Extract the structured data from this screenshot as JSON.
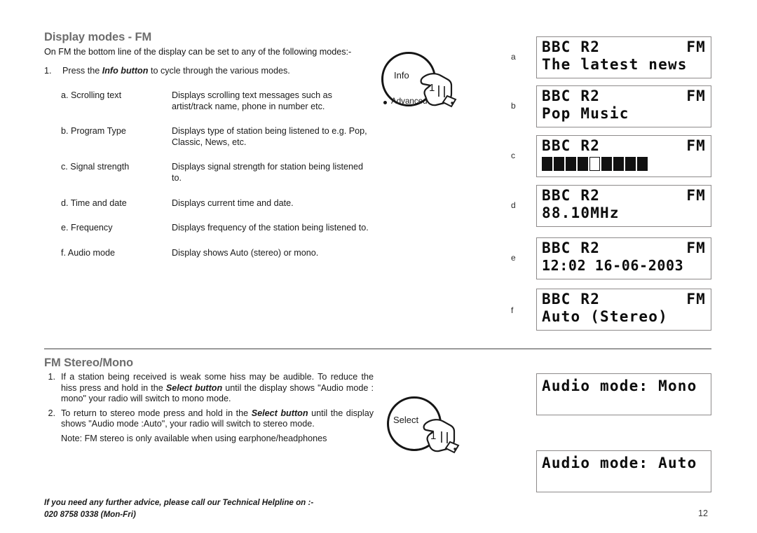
{
  "document": {
    "page_number": "12"
  },
  "section1": {
    "heading": "Display modes - FM",
    "intro": "On FM the bottom line of the display can be set to any of the following modes:-",
    "step": {
      "num": "1.",
      "before": "Press the ",
      "bold": "Info button",
      "after": " to cycle through the various modes."
    },
    "modes": [
      {
        "label": "a. Scrolling text",
        "desc": "Displays scrolling text messages such as artist/track name, phone in number etc."
      },
      {
        "label": "b. Program Type",
        "desc": "Displays type of station being listened to e.g. Pop, Classic, News, etc."
      },
      {
        "label": "c. Signal strength",
        "desc": "Displays signal strength for station being listened to."
      },
      {
        "label": "d. Time and date",
        "desc": "Displays current time and date."
      },
      {
        "label": "e. Frequency",
        "desc": "Displays frequency of the station being listened to."
      },
      {
        "label": "f. Audio mode",
        "desc": "Display shows Auto (stereo) or mono."
      }
    ]
  },
  "info_button": {
    "label": "Info",
    "sub_label": "Advanced",
    "finger_number": "1"
  },
  "select_button": {
    "label": "Select",
    "finger_number": "1"
  },
  "displays": [
    {
      "letter": "a",
      "line1_left": "BBC R2",
      "line1_right": "FM",
      "line2": "The latest news",
      "type": "text"
    },
    {
      "letter": "b",
      "line1_left": "BBC R2",
      "line1_right": "FM",
      "line2": "Pop Music",
      "type": "text"
    },
    {
      "letter": "c",
      "line1_left": "BBC R2",
      "line1_right": "FM",
      "line2": "",
      "type": "signal",
      "signal_blocks": [
        "filled",
        "filled",
        "filled",
        "filled",
        "empty",
        "filled",
        "filled",
        "filled",
        "filled"
      ]
    },
    {
      "letter": "d",
      "line1_left": "BBC R2",
      "line1_right": "FM",
      "line2": "88.10MHz",
      "type": "text"
    },
    {
      "letter": "e",
      "line1_left": "BBC R2",
      "line1_right": "FM",
      "line2": "12:02 16-06-2003",
      "type": "text"
    },
    {
      "letter": "f",
      "line1_left": "BBC R2",
      "line1_right": "FM",
      "line2": "Auto (Stereo)",
      "type": "text"
    }
  ],
  "section2": {
    "heading": "FM Stereo/Mono",
    "items": [
      {
        "num": "1.",
        "before": "If a station being received is weak some hiss may be audible. To reduce the hiss press and hold in the ",
        "bold": "Select button",
        "after": " until the display shows \"Audio mode : mono\" your radio will  switch to mono mode."
      },
      {
        "num": "2.",
        "before": "To return to stereo mode press and  hold in the ",
        "bold": "Select button",
        "after": " until the display shows \"Audio mode :Auto\", your radio will  switch to stereo mode."
      }
    ],
    "note": "Note: FM stereo is only available when using earphone/headphones"
  },
  "audio_displays": [
    {
      "line1": "Audio mode: Mono"
    },
    {
      "line1": "Audio mode: Auto"
    }
  ],
  "footer": {
    "line1": "If you need any further advice, please call our Technical Helpline on :-",
    "line2": "020 8758 0338 (Mon-Fri)"
  }
}
